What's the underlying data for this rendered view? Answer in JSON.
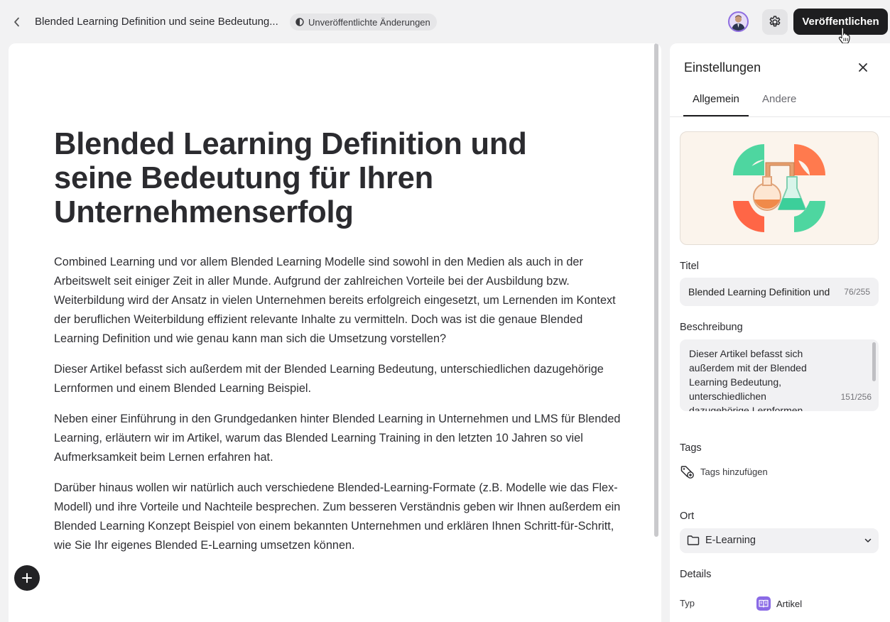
{
  "topbar": {
    "document_title": "Blended Learning Definition und seine Bedeutung...",
    "status": "Unveröffentlichte Änderungen",
    "publish_label": "Veröffentlichen"
  },
  "editor": {
    "title": "Blended Learning Definition und seine Bedeutung für Ihren Unternehmenserfolg",
    "paragraphs": [
      "Combined Learning und vor allem Blended Learning Modelle sind sowohl in den Medien als auch in der Arbeitswelt seit einiger Zeit in aller Munde. Aufgrund der zahlreichen Vorteile bei der Ausbildung bzw. Weiterbildung wird der Ansatz in vielen Unternehmen bereits erfolgreich eingesetzt, um Lernenden im Kontext der beruflichen Weiterbildung effizient relevante Inhalte zu vermitteln. Doch was ist die genaue Blended Learning Definition und wie genau kann man sich die Umsetzung vorstellen?",
      "Dieser Artikel befasst sich außerdem mit der Blended Learning Bedeutung, unterschiedlichen dazugehörige Lernformen und einem Blended Learning Beispiel.",
      "Neben einer Einführung in den Grundgedanken hinter Blended Learning in Unternehmen und LMS für Blended Learning, erläutern wir im Artikel, warum das Blended Learning Training in den letzten 10 Jahren so viel Aufmerksamkeit beim Lernen erfahren hat.",
      "Darüber hinaus wollen wir natürlich auch verschiedene Blended-Learning-Formate (z.B. Modelle wie das Flex-Modell) und ihre Vorteile und Nachteile besprechen. Zum besseren Verständnis geben wir Ihnen außerdem ein Blended Learning Konzept Beispiel von einem bekannten Unternehmen und erklären Ihnen Schritt-für-Schritt, wie Sie Ihr eigenes Blended E-Learning umsetzen können."
    ]
  },
  "settings": {
    "heading": "Einstellungen",
    "tabs": [
      {
        "label": "Allgemein",
        "active": true
      },
      {
        "label": "Andere",
        "active": false
      }
    ],
    "title_label": "Titel",
    "title_value": "Blended Learning Definition und seine Bedeutung für Ihren Unternehmenserfolg",
    "title_count": "76/255",
    "description_label": "Beschreibung",
    "description_value": "Dieser Artikel befasst sich außerdem mit der Blended Learning Bedeutung, unterschiedlichen dazugehörige Lernformen",
    "description_count": "151/256",
    "tags_label": "Tags",
    "tags_add": "Tags hinzufügen",
    "location_label": "Ort",
    "location_value": "E-Learning",
    "details_label": "Details",
    "type_label": "Typ",
    "type_value": "Artikel"
  },
  "colors": {
    "accent_dark": "#1e1e20",
    "type_badge": "#8a6ae6",
    "avatar_ring": "#8f6ee0",
    "thumb_bg": "#fbf4ec"
  },
  "icons": [
    "chevron-left-icon",
    "half-circle-icon",
    "avatar",
    "gear-icon",
    "close-icon",
    "plus-icon",
    "tag-add-icon",
    "folder-icon",
    "chevron-down-icon",
    "book-icon",
    "cursor-hand-icon"
  ]
}
